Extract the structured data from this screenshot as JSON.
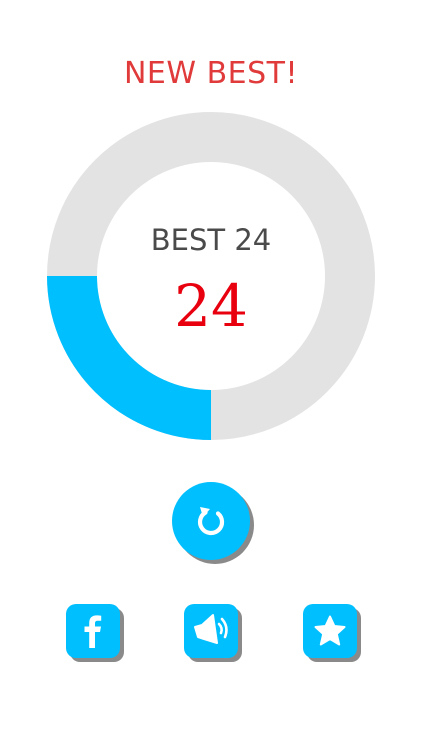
{
  "header": {
    "new_best_text": "NEW BEST!"
  },
  "score_panel": {
    "best_label": "BEST 24",
    "score": "24",
    "progress_fraction": 0.25
  },
  "buttons": {
    "replay": {
      "icon": "replay-icon"
    },
    "facebook": {
      "icon": "facebook-icon",
      "letter": "f"
    },
    "sound": {
      "icon": "speaker-icon"
    },
    "rate": {
      "icon": "star-icon"
    }
  },
  "colors": {
    "accent": "#00bfff",
    "new_best": "#e03a3a",
    "score": "#e8000f",
    "ring_track": "#e3e3e3",
    "button_shadow": "#8a8a8a"
  }
}
